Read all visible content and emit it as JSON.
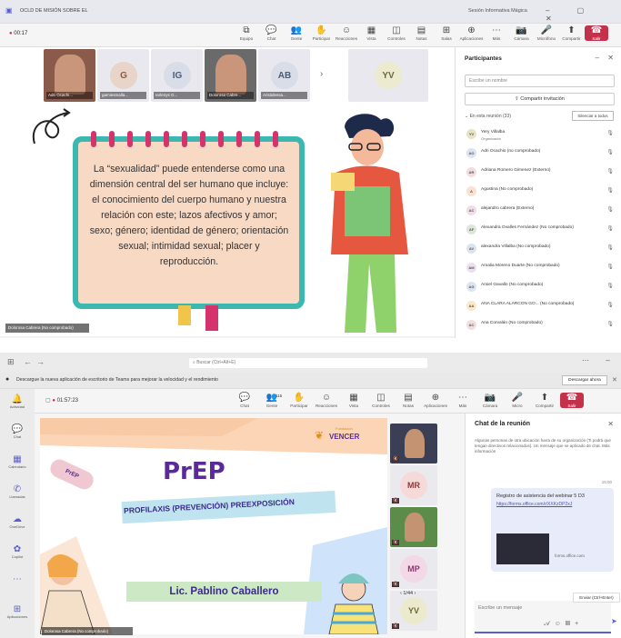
{
  "top": {
    "window_title": "OCLD DE MISIÓN SOBRE EL",
    "meeting_title": "Sesión Informativa Mágica",
    "timer": "00:17",
    "toolbar": [
      {
        "label": "Equipo",
        "icon": "⧉"
      },
      {
        "label": "Chat",
        "icon": "💬"
      },
      {
        "label": "Gente",
        "icon": "👥"
      },
      {
        "label": "Participar",
        "icon": "✋"
      },
      {
        "label": "Reacciones",
        "icon": "☺"
      },
      {
        "label": "Vista",
        "icon": "▦"
      },
      {
        "label": "Controles",
        "icon": "◫"
      },
      {
        "label": "Notas",
        "icon": "▤"
      },
      {
        "label": "Salas",
        "icon": "⊞"
      },
      {
        "label": "Aplicaciones",
        "icon": "⊕"
      },
      {
        "label": "Más",
        "icon": "⋯"
      },
      {
        "label": "Cámara",
        "icon": "📷"
      },
      {
        "label": "Micrófono",
        "icon": "🎤"
      },
      {
        "label": "Compartir",
        "icon": "⬆"
      },
      {
        "label": "Salir",
        "icon": "☎"
      }
    ],
    "tiles": [
      {
        "name": "Adri Ocachi...",
        "initials": "",
        "color": "#8a5a4a",
        "photo": true
      },
      {
        "name": "gamiesmalla...",
        "initials": "G",
        "color": "#e8d4c8",
        "text": "#8a5a4a"
      },
      {
        "name": "Iarlenys G...",
        "initials": "IG",
        "color": "#d8dde8",
        "text": "#4a5a7a"
      },
      {
        "name": "Dolorosa Cabre...",
        "initials": "",
        "color": "#6a6a6a",
        "photo": true
      },
      {
        "name": "Aristidessa...",
        "initials": "AB",
        "color": "#d8dde8",
        "text": "#4a5a7a"
      },
      {
        "name": "",
        "initials": "YV",
        "color": "#ecebd0",
        "text": "#6a6a3a"
      }
    ],
    "slide_text": "La “sexualidad” puede entenderse como una dimensión central del ser humano que incluye: el conocimiento del cuerpo humano y nuestra relación con este; lazos afectivos y amor; sexo; género; identidad de género; orientación sexual; intimidad sexual; placer y reproducción.",
    "speaker": "Dolorosa Cabrera (No comprobado)",
    "participants": {
      "title": "Participantes",
      "search_placeholder": "Escribe un nombre",
      "share_label": "Compartir invitación",
      "in_meeting": "En esta reunión (33)",
      "mute_all": "Silenciar a todos",
      "list": [
        {
          "initials": "YV",
          "name": "Yery Villalba",
          "role": "Organizador",
          "color": "#e6e4c4"
        },
        {
          "initials": "AO",
          "name": "Adri Ocachio (no comprobado)",
          "role": "",
          "color": "#dde3f0"
        },
        {
          "initials": "AR",
          "name": "Adriana Romero Gimenez (Externo)",
          "role": "",
          "color": "#f2dede"
        },
        {
          "initials": "A",
          "name": "Agustina (No comprobado)",
          "role": "",
          "color": "#fbe2d0"
        },
        {
          "initials": "AC",
          "name": "alejandro cabrera (Externo)",
          "role": "",
          "color": "#f0dde8"
        },
        {
          "initials": "AF",
          "name": "Alexandra Ovalles Fernández (No comprobado)",
          "role": "",
          "color": "#dde6d8"
        },
        {
          "initials": "AV",
          "name": "alexandra Villalba (No comprobado)",
          "role": "",
          "color": "#dde3f0"
        },
        {
          "initials": "AM",
          "name": "Amalia Moreno Duarte (No comprobado)",
          "role": "",
          "color": "#ece0f0"
        },
        {
          "initials": "AG",
          "name": "Amiel Gavallo (No comprobado)",
          "role": "",
          "color": "#dde3f0"
        },
        {
          "initials": "AA",
          "name": "ANA CLARA ALARCON GO... (No comprobado)",
          "role": "",
          "color": "#fbe8c8"
        },
        {
          "initials": "AC",
          "name": "Ana Corvalán (No comprobado)",
          "role": "",
          "color": "#f2dede"
        }
      ]
    }
  },
  "bottom": {
    "search_placeholder": "Buscar (Ctrl+Alt+E)",
    "banner": "Descargue la nueva aplicación de escritorio de Teams para mejorar la velocidad y el rendimiento",
    "download": "Descargar ahora",
    "timer": "01:57:23",
    "rail": [
      {
        "label": "Actividad",
        "icon": "🔔"
      },
      {
        "label": "Chat",
        "icon": "💬"
      },
      {
        "label": "Calendario",
        "icon": "▦"
      },
      {
        "label": "Llamadas",
        "icon": "✆"
      },
      {
        "label": "OneDrive",
        "icon": "☁"
      },
      {
        "label": "Copilot",
        "icon": "✿"
      },
      {
        "label": "",
        "icon": "⋯"
      },
      {
        "label": "Aplicaciones",
        "icon": "⊞"
      }
    ],
    "toolbar": [
      {
        "label": "Chat",
        "icon": "💬"
      },
      {
        "label": "Gente",
        "icon": "👥"
      },
      {
        "label": "Participar",
        "icon": "✋"
      },
      {
        "label": "Reacciones",
        "icon": "☺"
      },
      {
        "label": "Vista",
        "icon": "▦"
      },
      {
        "label": "Controles",
        "icon": "◫"
      },
      {
        "label": "Notas",
        "icon": "▤"
      },
      {
        "label": "Aplicaciones",
        "icon": "⊕"
      },
      {
        "label": "Más",
        "icon": "⋯"
      },
      {
        "label": "Cámara",
        "icon": "📷"
      },
      {
        "label": "Micro",
        "icon": "🎤"
      },
      {
        "label": "Compartir",
        "icon": "⬆"
      },
      {
        "label": "Salir",
        "icon": "☎"
      }
    ],
    "people_count": "115",
    "slide": {
      "brand_small": "Fundación",
      "brand": "VENCER",
      "pill": "PrEP",
      "title": "PrEP",
      "subtitle": "PROFILAXIS (PREVENCIÓN) PREEXPOSICIÓN",
      "presenter": "Lic. Pablino Caballero"
    },
    "speaker": "Dolorosa Cabrera (No comprobado)",
    "side_tiles": [
      {
        "initials": "",
        "color": "#3a3f55",
        "photo": true
      },
      {
        "initials": "MR",
        "color": "#f6dada",
        "text": "#8a3a3a"
      },
      {
        "initials": "",
        "color": "#5c8c4a",
        "photo": true
      },
      {
        "initials": "MP",
        "color": "#f3d8e8",
        "text": "#8a3a6a"
      },
      {
        "initials": "YV",
        "color": "#eceacc",
        "text": "#6a6a3a"
      }
    ],
    "pager": "1/44",
    "chat": {
      "title": "Chat de la reunión",
      "note": "Algunas personas de otra ubicación fuera de su organización (Ti podrá que tengan directivos relacionados). Un mensaje que se aplicado de chat. Más información",
      "time": "15:00",
      "message_title": "Registro de asistencia del webinar 5 D3",
      "message_link": "https://forms.office.com/r/XXKzDP2xJ",
      "thumb_caption": "forms.office.com",
      "compose_placeholder": "Escribe un mensaje",
      "send_tooltip": "Enviar (Ctrl+Enter)"
    }
  }
}
